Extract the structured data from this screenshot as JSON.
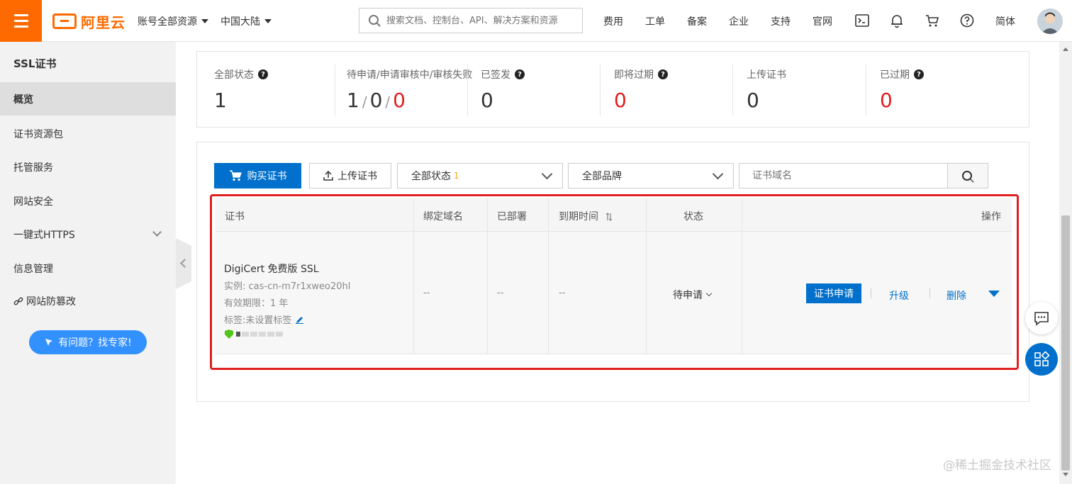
{
  "header": {
    "logo_text": "阿里云",
    "account_scope": "账号全部资源",
    "region": "中国大陆",
    "search_placeholder": "搜索文档、控制台、API、解决方案和资源",
    "nav": [
      "费用",
      "工单",
      "备案",
      "企业",
      "支持",
      "官网"
    ],
    "language": "简体"
  },
  "sidebar": {
    "title": "SSL证书",
    "items": [
      {
        "label": "概览",
        "active": true
      },
      {
        "label": "证书资源包"
      },
      {
        "label": "托管服务"
      },
      {
        "label": "网站安全"
      },
      {
        "label": "一键式HTTPS",
        "expandable": true
      },
      {
        "label": "信息管理"
      },
      {
        "label": "网站防篡改"
      }
    ],
    "help_button": "有问题？找专家!"
  },
  "stats": {
    "all": {
      "label": "全部状态",
      "value": "1"
    },
    "pending": {
      "label": "待申请/申请审核中/审核失败",
      "values": [
        "1",
        "0",
        "0"
      ]
    },
    "issued": {
      "label": "已签发",
      "value": "0"
    },
    "expiring": {
      "label": "即将过期",
      "value": "0"
    },
    "uploaded": {
      "label": "上传证书",
      "value": "0"
    },
    "expired": {
      "label": "已过期",
      "value": "0"
    }
  },
  "toolbar": {
    "buy_label": "购买证书",
    "upload_label": "上传证书",
    "status_filter": "全部状态",
    "status_count": "1",
    "brand_filter": "全部品牌",
    "domain_placeholder": "证书域名"
  },
  "table": {
    "columns": [
      "证书",
      "绑定域名",
      "已部署",
      "到期时间",
      "状态",
      "操作"
    ],
    "rows": [
      {
        "name": "DigiCert 免费版 SSL",
        "instance": "实例: cas-cn-m7r1xweo20hl",
        "validity": "有效期限：1 年",
        "tags": "标签:未设置标签",
        "domain": "--",
        "deployed": "--",
        "expiry": "--",
        "status": "待申请",
        "actions": {
          "apply": "证书申请",
          "upgrade": "升级",
          "delete": "删除"
        }
      }
    ]
  },
  "watermark": "@稀土掘金技术社区",
  "colors": {
    "brand_orange": "#ff6a00",
    "primary_blue": "#0070cc",
    "alert_red": "#e02020",
    "help_blue": "#3390ff"
  }
}
